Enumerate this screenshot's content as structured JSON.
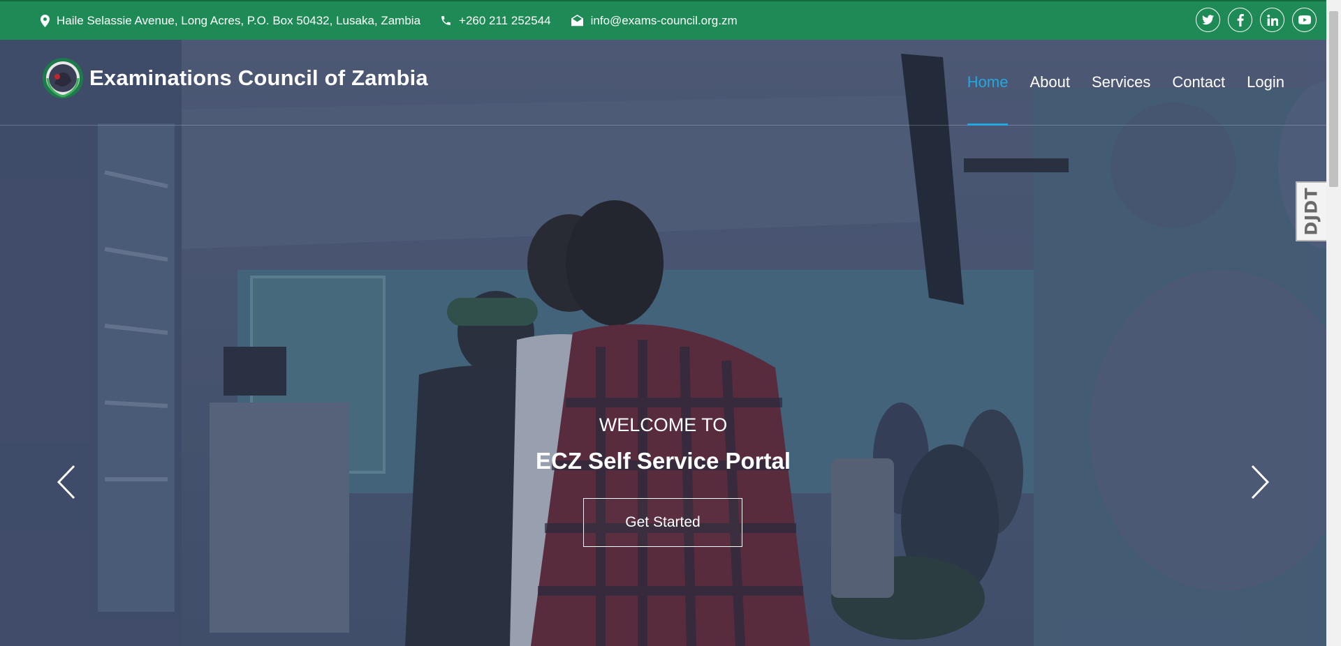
{
  "topbar": {
    "address": "Haile Selassie Avenue, Long Acres, P.O. Box 50432, Lusaka, Zambia",
    "phone": "+260 211 252544",
    "email": "info@exams-council.org.zm",
    "bg_color": "#1e8a55",
    "icons": {
      "address": "map-pin-icon",
      "phone": "phone-icon",
      "email": "envelope-icon"
    },
    "social": [
      "twitter-icon",
      "facebook-icon",
      "linkedin-icon",
      "youtube-icon"
    ]
  },
  "header": {
    "brand_name": "Examinations Council of Zambia",
    "logo_icon": "ecz-logo"
  },
  "nav": {
    "items": [
      {
        "label": "Home",
        "active": true
      },
      {
        "label": "About",
        "active": false
      },
      {
        "label": "Services",
        "active": false
      },
      {
        "label": "Contact",
        "active": false
      },
      {
        "label": "Login",
        "active": false
      }
    ],
    "active_color": "#22a8e0"
  },
  "hero": {
    "welcome": "WELCOME TO",
    "title": "ECZ Self Service Portal",
    "cta_label": "Get Started",
    "prev_icon": "chevron-left-icon",
    "next_icon": "chevron-right-icon"
  },
  "sidetab": {
    "label": "DJDT"
  }
}
